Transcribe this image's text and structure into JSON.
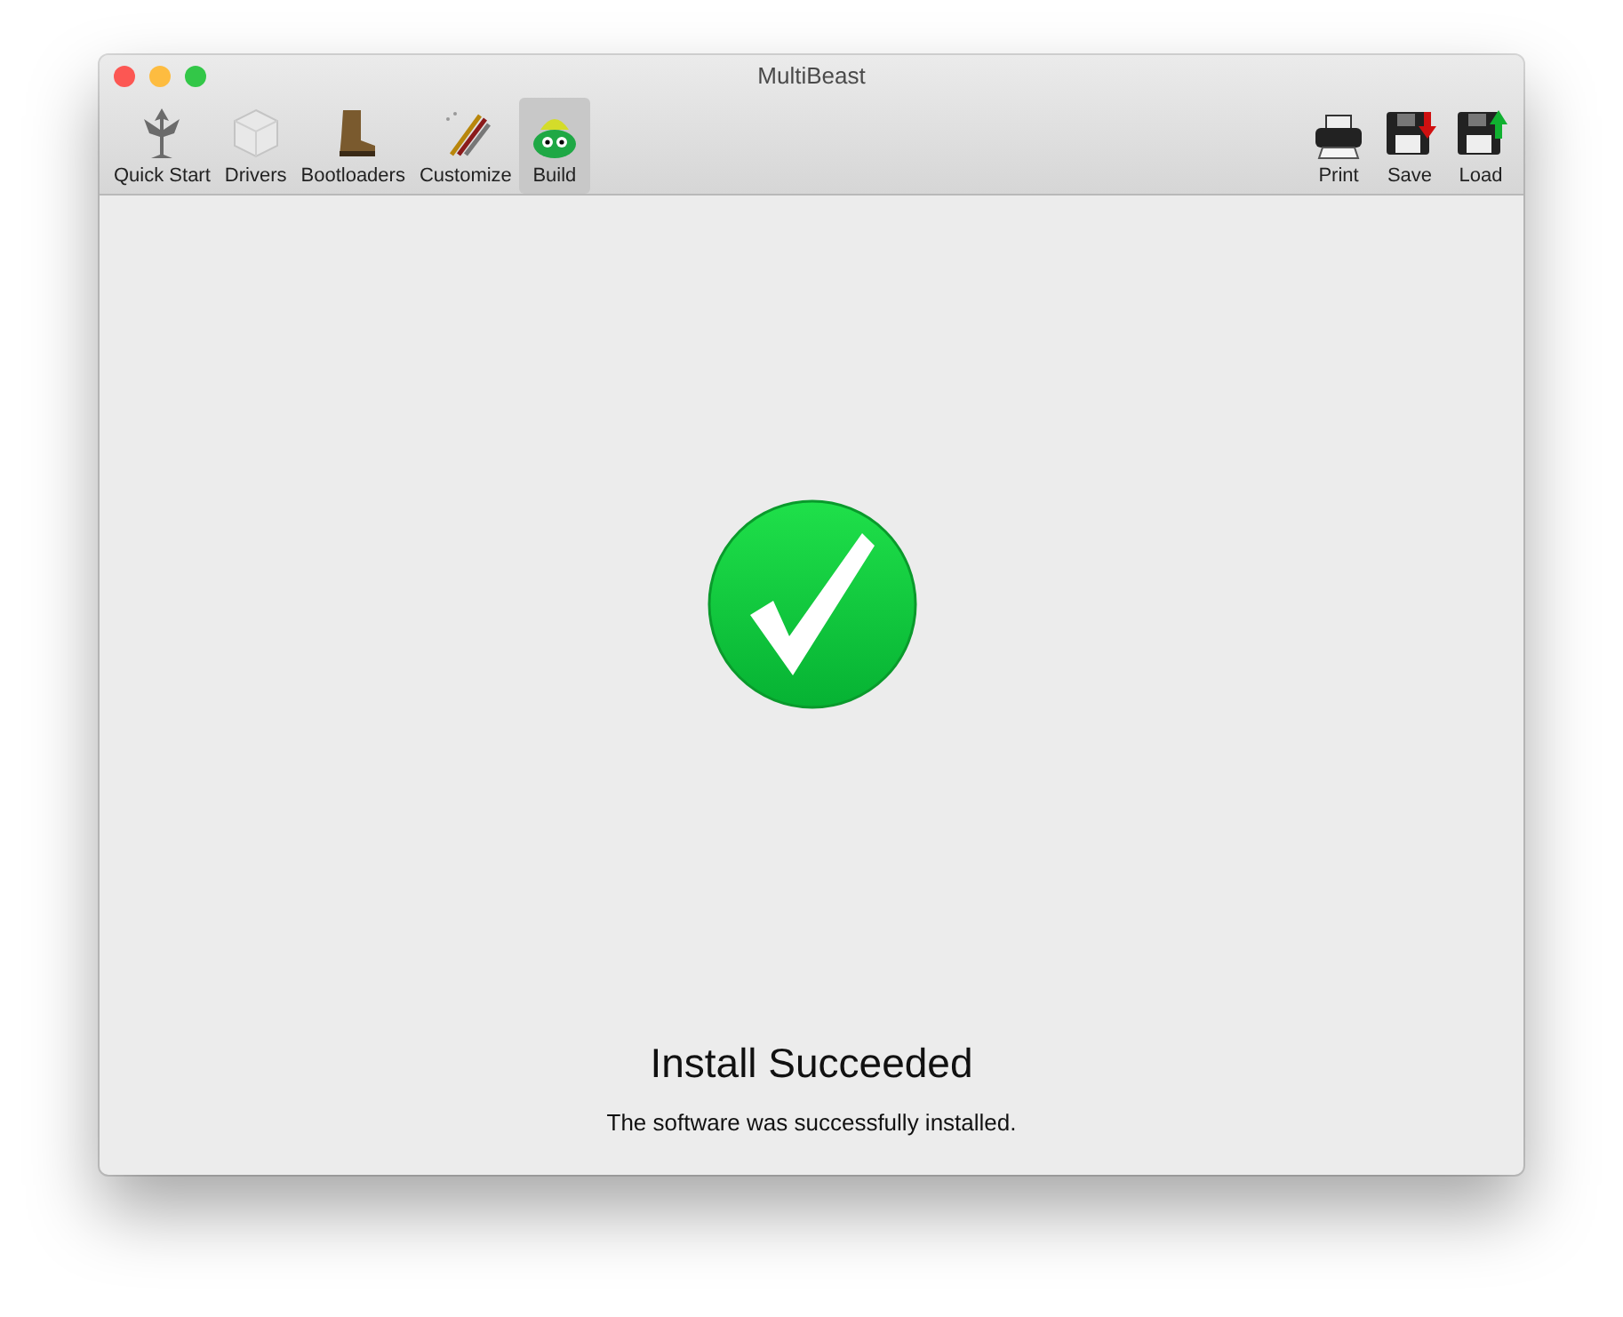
{
  "window": {
    "title": "MultiBeast"
  },
  "toolbar": {
    "tabs": [
      {
        "label": "Quick Start",
        "selected": false
      },
      {
        "label": "Drivers",
        "selected": false
      },
      {
        "label": "Bootloaders",
        "selected": false
      },
      {
        "label": "Customize",
        "selected": false
      },
      {
        "label": "Build",
        "selected": true
      }
    ],
    "actions": [
      {
        "label": "Print"
      },
      {
        "label": "Save"
      },
      {
        "label": "Load"
      }
    ]
  },
  "result": {
    "heading": "Install Succeeded",
    "message": "The software was successfully installed."
  }
}
